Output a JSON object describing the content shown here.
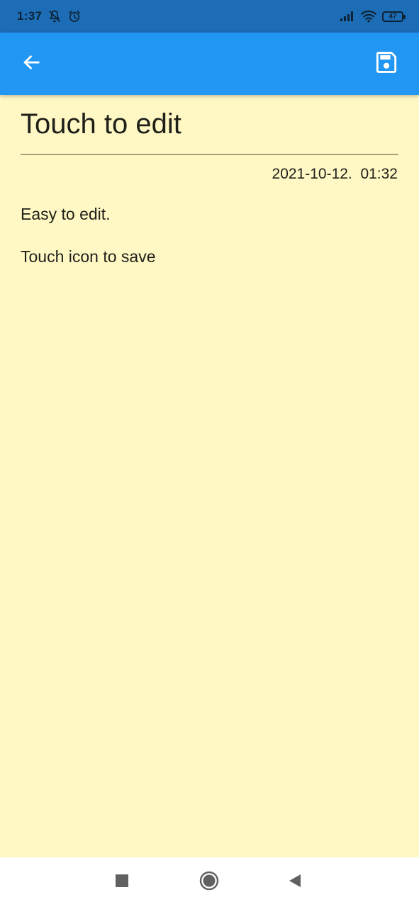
{
  "status_bar": {
    "time": "1:37",
    "battery_level": "47",
    "icons": [
      "notifications-off-icon",
      "alarm-icon",
      "signal-icon",
      "wifi-icon",
      "battery-icon"
    ]
  },
  "app_bar": {
    "color": "#2196f3",
    "back_icon": "arrow-back-icon",
    "save_icon": "save-icon"
  },
  "note": {
    "background": "#fff8c4",
    "title": "Touch to edit",
    "date": "2021-10-12.  01:32",
    "lines": [
      "Easy to edit.",
      "Touch icon to save"
    ]
  },
  "nav_bar": {
    "buttons": [
      "recents-square-icon",
      "home-circle-icon",
      "back-triangle-icon"
    ]
  }
}
